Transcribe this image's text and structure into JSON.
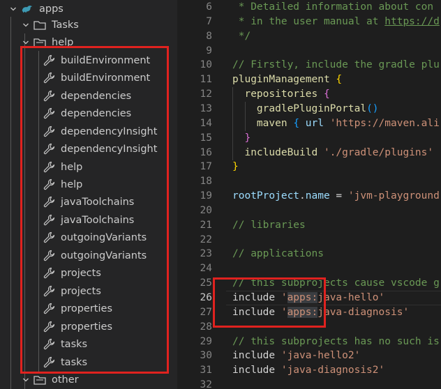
{
  "explorer": {
    "items": [
      {
        "label": "apps",
        "type": "root"
      },
      {
        "label": "Tasks",
        "type": "folder"
      },
      {
        "label": "help",
        "type": "group"
      },
      {
        "label": "buildEnvironment",
        "type": "task"
      },
      {
        "label": "buildEnvironment",
        "type": "task"
      },
      {
        "label": "dependencies",
        "type": "task"
      },
      {
        "label": "dependencies",
        "type": "task"
      },
      {
        "label": "dependencyInsight",
        "type": "task"
      },
      {
        "label": "dependencyInsight",
        "type": "task"
      },
      {
        "label": "help",
        "type": "task"
      },
      {
        "label": "help",
        "type": "task"
      },
      {
        "label": "javaToolchains",
        "type": "task"
      },
      {
        "label": "javaToolchains",
        "type": "task"
      },
      {
        "label": "outgoingVariants",
        "type": "task"
      },
      {
        "label": "outgoingVariants",
        "type": "task"
      },
      {
        "label": "projects",
        "type": "task"
      },
      {
        "label": "projects",
        "type": "task"
      },
      {
        "label": "properties",
        "type": "task"
      },
      {
        "label": "properties",
        "type": "task"
      },
      {
        "label": "tasks",
        "type": "task"
      },
      {
        "label": "tasks",
        "type": "task"
      },
      {
        "label": "other",
        "type": "group"
      }
    ]
  },
  "editor": {
    "active_line": 26,
    "lines": [
      {
        "n": 6,
        "indent": 0,
        "toks": [
          [
            " * Detailed information about con",
            "comment"
          ]
        ]
      },
      {
        "n": 7,
        "indent": 0,
        "toks": [
          [
            " * in the user manual at ",
            "comment"
          ],
          [
            "https://d",
            "link"
          ]
        ]
      },
      {
        "n": 8,
        "indent": 0,
        "toks": [
          [
            " */",
            "comment"
          ]
        ]
      },
      {
        "n": 9,
        "indent": 0,
        "toks": []
      },
      {
        "n": 10,
        "indent": 0,
        "toks": [
          [
            "// Firstly, include the gradle plu",
            "comment"
          ]
        ]
      },
      {
        "n": 11,
        "indent": 0,
        "toks": [
          [
            "pluginManagement",
            "fn"
          ],
          [
            " ",
            "plain"
          ],
          [
            "{",
            "brace1"
          ]
        ]
      },
      {
        "n": 12,
        "indent": 1,
        "toks": [
          [
            "  repositories",
            "fn"
          ],
          [
            " ",
            "plain"
          ],
          [
            "{",
            "brace2"
          ]
        ]
      },
      {
        "n": 13,
        "indent": 2,
        "toks": [
          [
            "    gradlePluginPortal",
            "fn"
          ],
          [
            "()",
            "brace3"
          ]
        ]
      },
      {
        "n": 14,
        "indent": 2,
        "toks": [
          [
            "    maven",
            "fn"
          ],
          [
            " ",
            "plain"
          ],
          [
            "{",
            "brace3"
          ],
          [
            " url ",
            "var"
          ],
          [
            "'https://maven.ali",
            "str"
          ]
        ]
      },
      {
        "n": 15,
        "indent": 1,
        "toks": [
          [
            "  ",
            "plain"
          ],
          [
            "}",
            "brace2"
          ]
        ]
      },
      {
        "n": 16,
        "indent": 1,
        "toks": [
          [
            "  includeBuild",
            "fn"
          ],
          [
            " ",
            "plain"
          ],
          [
            "'./gradle/plugins'",
            "str"
          ]
        ]
      },
      {
        "n": 17,
        "indent": 0,
        "toks": [
          [
            "}",
            "brace1"
          ]
        ]
      },
      {
        "n": 18,
        "indent": 0,
        "toks": []
      },
      {
        "n": 19,
        "indent": 0,
        "toks": [
          [
            "rootProject",
            "var"
          ],
          [
            ".",
            "plain"
          ],
          [
            "name",
            "var"
          ],
          [
            " = ",
            "plain"
          ],
          [
            "'jvm-playground",
            "str"
          ]
        ]
      },
      {
        "n": 20,
        "indent": 0,
        "toks": []
      },
      {
        "n": 21,
        "indent": 0,
        "toks": [
          [
            "// libraries",
            "comment"
          ]
        ]
      },
      {
        "n": 22,
        "indent": 0,
        "toks": []
      },
      {
        "n": 23,
        "indent": 0,
        "toks": [
          [
            "// applications",
            "comment"
          ]
        ]
      },
      {
        "n": 24,
        "indent": 0,
        "toks": []
      },
      {
        "n": 25,
        "indent": 0,
        "toks": [
          [
            "// this subprojects cause vscode g",
            "comment"
          ]
        ]
      },
      {
        "n": 26,
        "indent": 0,
        "toks": [
          [
            "include ",
            "plain"
          ],
          [
            "'",
            "str"
          ],
          [
            "apps:",
            "strhl"
          ],
          [
            "java-hello'",
            "str"
          ]
        ]
      },
      {
        "n": 27,
        "indent": 0,
        "toks": [
          [
            "include ",
            "plain"
          ],
          [
            "'",
            "str"
          ],
          [
            "apps:",
            "strhl"
          ],
          [
            "java-diagnosis'",
            "str"
          ]
        ]
      },
      {
        "n": 28,
        "indent": 0,
        "toks": []
      },
      {
        "n": 29,
        "indent": 0,
        "toks": [
          [
            "// this subprojects has no such is",
            "comment"
          ]
        ]
      },
      {
        "n": 30,
        "indent": 0,
        "toks": [
          [
            "include ",
            "plain"
          ],
          [
            "'java-hello2'",
            "str"
          ]
        ]
      },
      {
        "n": 31,
        "indent": 0,
        "toks": [
          [
            "include ",
            "plain"
          ],
          [
            "'java-diagnosis2'",
            "str"
          ]
        ]
      },
      {
        "n": 32,
        "indent": 0,
        "toks": []
      }
    ]
  },
  "colors": {
    "highlight_box": "#e0221f",
    "sidebar_bg": "#252526",
    "editor_bg": "#1e1e1e"
  }
}
